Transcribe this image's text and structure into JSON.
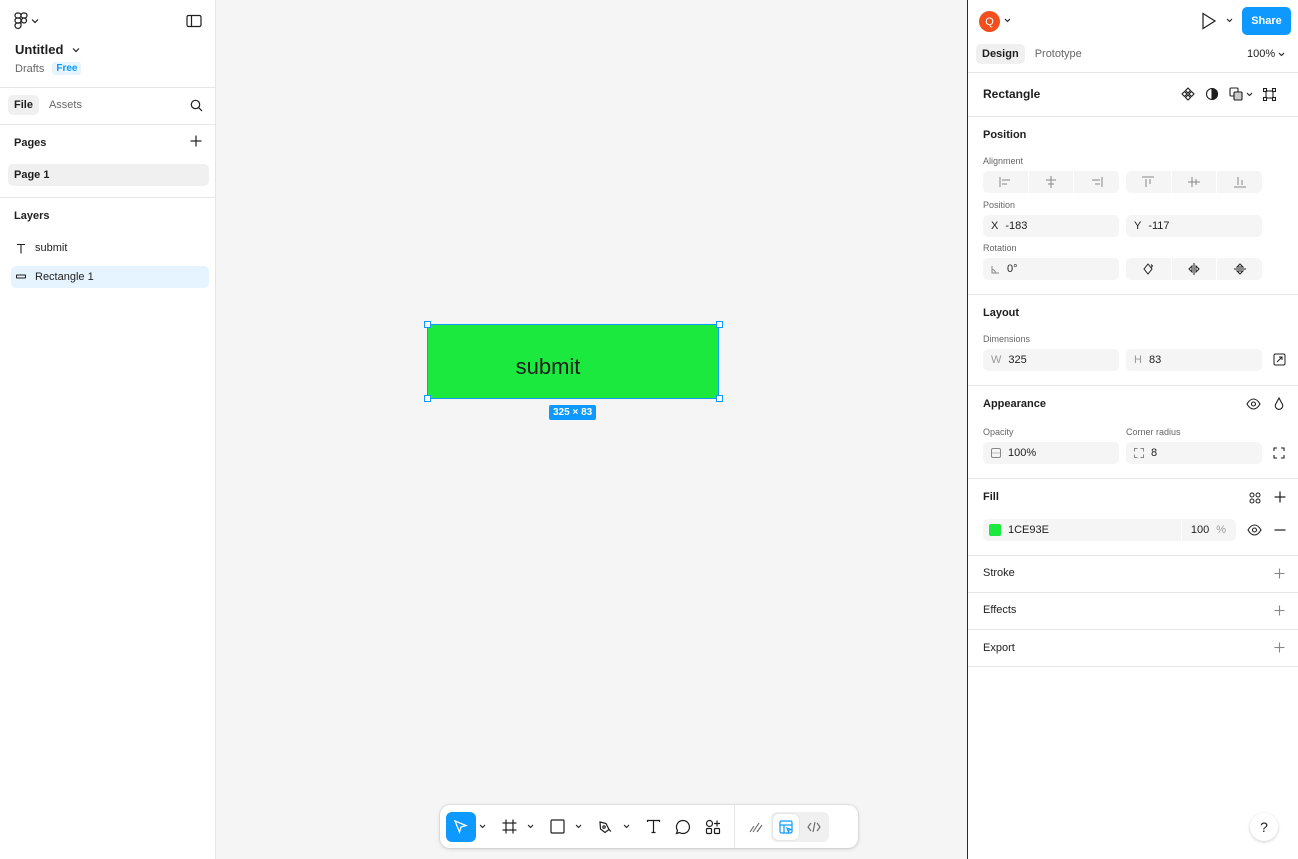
{
  "file": {
    "title": "Untitled",
    "location": "Drafts",
    "plan_badge": "Free"
  },
  "left_tabs": [
    "File",
    "Assets"
  ],
  "pages": {
    "header": "Pages",
    "items": [
      "Page 1"
    ]
  },
  "layers": {
    "header": "Layers",
    "items": [
      {
        "name": "submit",
        "type": "text"
      },
      {
        "name": "Rectangle 1",
        "type": "rectangle"
      }
    ]
  },
  "canvas": {
    "rect_text": "submit",
    "size_badge": "325 × 83",
    "fill_color": "#1CE93E"
  },
  "header_right": {
    "avatar_initial": "Q",
    "share_label": "Share",
    "zoom": "100%"
  },
  "right_tabs": [
    "Design",
    "Prototype"
  ],
  "selection": {
    "title": "Rectangle"
  },
  "position": {
    "header": "Position",
    "alignment_label": "Alignment",
    "position_label": "Position",
    "x_label": "X",
    "x": "-183",
    "y_label": "Y",
    "y": "-117",
    "rotation_label": "Rotation",
    "rotation": "0°"
  },
  "layout": {
    "header": "Layout",
    "dimensions_label": "Dimensions",
    "w_label": "W",
    "w": "325",
    "h_label": "H",
    "h": "83"
  },
  "appearance": {
    "header": "Appearance",
    "opacity_label": "Opacity",
    "opacity": "100%",
    "radius_label": "Corner radius",
    "radius": "8"
  },
  "fill": {
    "header": "Fill",
    "hex": "1CE93E",
    "opacity": "100",
    "percent": "%"
  },
  "stroke": {
    "header": "Stroke"
  },
  "effects": {
    "header": "Effects"
  },
  "export": {
    "header": "Export"
  },
  "help": "?",
  "colors": {
    "accent": "#0d99ff",
    "avatar": "#f24e1e",
    "fill": "#1ce93e"
  }
}
